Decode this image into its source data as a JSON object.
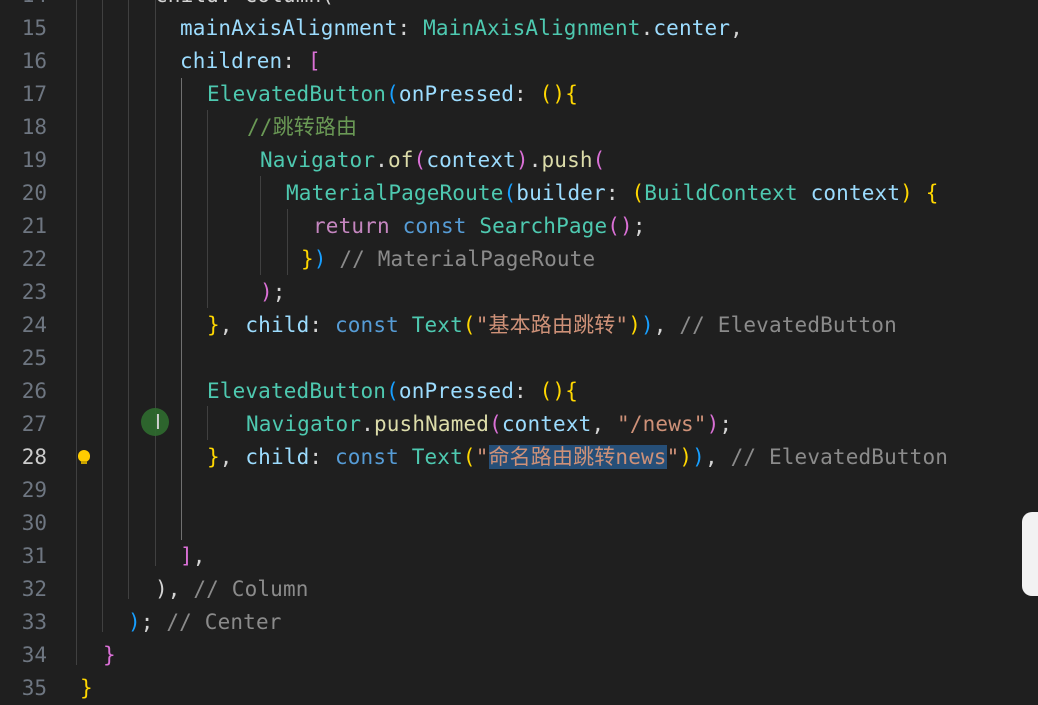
{
  "editor": {
    "language": "dart",
    "active_line": 28,
    "selected_text": "命名路由跳转news",
    "lines": [
      {
        "n": "14",
        "tokens": [
          {
            "t": "child: Column(",
            "c": "t-p"
          }
        ]
      },
      {
        "n": "15",
        "tokens": [
          {
            "t": "mainAxisAlignment",
            "c": "t-prop"
          },
          {
            "t": ": ",
            "c": "t-p"
          },
          {
            "t": "MainAxisAlignment",
            "c": "t-cls"
          },
          {
            "t": ".",
            "c": "t-p"
          },
          {
            "t": "center",
            "c": "t-prop"
          },
          {
            "t": ",",
            "c": "t-p"
          }
        ]
      },
      {
        "n": "16",
        "tokens": [
          {
            "t": "children",
            "c": "t-prop"
          },
          {
            "t": ": ",
            "c": "t-p"
          },
          {
            "t": "[",
            "c": "b2"
          }
        ]
      },
      {
        "n": "17",
        "tokens": [
          {
            "t": "ElevatedButton",
            "c": "t-cls"
          },
          {
            "t": "(",
            "c": "b3"
          },
          {
            "t": "onPressed",
            "c": "t-prop"
          },
          {
            "t": ": ",
            "c": "t-p"
          },
          {
            "t": "(){",
            "c": "b1"
          }
        ]
      },
      {
        "n": "18",
        "tokens": [
          {
            "t": "//跳转路由",
            "c": "t-com"
          }
        ]
      },
      {
        "n": "19",
        "tokens": [
          {
            "t": "Navigator",
            "c": "t-cls"
          },
          {
            "t": ".",
            "c": "t-p"
          },
          {
            "t": "of",
            "c": "t-fn"
          },
          {
            "t": "(",
            "c": "b2"
          },
          {
            "t": "context",
            "c": "t-prop"
          },
          {
            "t": ")",
            "c": "b2"
          },
          {
            "t": ".",
            "c": "t-p"
          },
          {
            "t": "push",
            "c": "t-fn"
          },
          {
            "t": "(",
            "c": "b2"
          }
        ]
      },
      {
        "n": "20",
        "tokens": [
          {
            "t": "MaterialPageRoute",
            "c": "t-cls"
          },
          {
            "t": "(",
            "c": "b3"
          },
          {
            "t": "builder",
            "c": "t-prop"
          },
          {
            "t": ": ",
            "c": "t-p"
          },
          {
            "t": "(",
            "c": "b1"
          },
          {
            "t": "BuildContext",
            "c": "t-cls"
          },
          {
            "t": " ",
            "c": "t-p"
          },
          {
            "t": "context",
            "c": "t-prop"
          },
          {
            "t": ")",
            "c": "b1"
          },
          {
            "t": " ",
            "c": "t-p"
          },
          {
            "t": "{",
            "c": "b1"
          }
        ]
      },
      {
        "n": "21",
        "tokens": [
          {
            "t": "return",
            "c": "t-ctrl"
          },
          {
            "t": " ",
            "c": "t-p"
          },
          {
            "t": "const",
            "c": "t-kw"
          },
          {
            "t": " ",
            "c": "t-p"
          },
          {
            "t": "SearchPage",
            "c": "t-cls"
          },
          {
            "t": "()",
            "c": "b2"
          },
          {
            "t": ";",
            "c": "t-p"
          }
        ]
      },
      {
        "n": "22",
        "tokens": [
          {
            "t": "}",
            "c": "b1"
          },
          {
            "t": ")",
            "c": "b3"
          },
          {
            "t": " // MaterialPageRoute",
            "c": "t-com2"
          }
        ]
      },
      {
        "n": "23",
        "tokens": [
          {
            "t": ")",
            "c": "b2"
          },
          {
            "t": ";",
            "c": "t-p"
          }
        ]
      },
      {
        "n": "24",
        "tokens": [
          {
            "t": "}",
            "c": "b1"
          },
          {
            "t": ", ",
            "c": "t-p"
          },
          {
            "t": "child",
            "c": "t-prop"
          },
          {
            "t": ": ",
            "c": "t-p"
          },
          {
            "t": "const",
            "c": "t-kw"
          },
          {
            "t": " ",
            "c": "t-p"
          },
          {
            "t": "Text",
            "c": "t-cls"
          },
          {
            "t": "(",
            "c": "b1"
          },
          {
            "t": "\"基本路由跳转\"",
            "c": "t-str"
          },
          {
            "t": ")",
            "c": "b1"
          },
          {
            "t": ")",
            "c": "b3"
          },
          {
            "t": ", ",
            "c": "t-p"
          },
          {
            "t": "// ElevatedButton",
            "c": "t-com2"
          }
        ]
      },
      {
        "n": "25",
        "tokens": []
      },
      {
        "n": "26",
        "tokens": [
          {
            "t": "ElevatedButton",
            "c": "t-cls"
          },
          {
            "t": "(",
            "c": "b3"
          },
          {
            "t": "onPressed",
            "c": "t-prop"
          },
          {
            "t": ": ",
            "c": "t-p"
          },
          {
            "t": "(){",
            "c": "b1"
          }
        ]
      },
      {
        "n": "27",
        "tokens": [
          {
            "t": "Navigator",
            "c": "t-cls"
          },
          {
            "t": ".",
            "c": "t-p"
          },
          {
            "t": "pushNamed",
            "c": "t-fn"
          },
          {
            "t": "(",
            "c": "b2"
          },
          {
            "t": "context",
            "c": "t-prop"
          },
          {
            "t": ", ",
            "c": "t-p"
          },
          {
            "t": "\"/news\"",
            "c": "t-str"
          },
          {
            "t": ")",
            "c": "b2"
          },
          {
            "t": ";",
            "c": "t-p"
          }
        ]
      },
      {
        "n": "28",
        "tokens": [
          {
            "t": "}",
            "c": "b1"
          },
          {
            "t": ", ",
            "c": "t-p"
          },
          {
            "t": "child",
            "c": "t-prop"
          },
          {
            "t": ": ",
            "c": "t-p"
          },
          {
            "t": "const",
            "c": "t-kw"
          },
          {
            "t": " ",
            "c": "t-p"
          },
          {
            "t": "Text",
            "c": "t-cls"
          },
          {
            "t": "(",
            "c": "b1"
          },
          {
            "t": "\"",
            "c": "t-str"
          },
          {
            "t": "命名路由跳转news",
            "c": "t-str sel"
          },
          {
            "t": "\"",
            "c": "t-str"
          },
          {
            "t": ")",
            "c": "b1"
          },
          {
            "t": ")",
            "c": "b3"
          },
          {
            "t": ", ",
            "c": "t-p"
          },
          {
            "t": "// ElevatedButton",
            "c": "t-com2"
          }
        ]
      },
      {
        "n": "29",
        "tokens": []
      },
      {
        "n": "30",
        "tokens": []
      },
      {
        "n": "31",
        "tokens": [
          {
            "t": "]",
            "c": "b2"
          },
          {
            "t": ",",
            "c": "t-p"
          }
        ]
      },
      {
        "n": "32",
        "tokens": [
          {
            "t": ")",
            "c": "t-p"
          },
          {
            "t": ", ",
            "c": "t-p"
          },
          {
            "t": "// Column",
            "c": "t-com2"
          }
        ]
      },
      {
        "n": "33",
        "tokens": [
          {
            "t": ")",
            "c": "b3"
          },
          {
            "t": "; ",
            "c": "t-p"
          },
          {
            "t": "// Center",
            "c": "t-com2"
          }
        ]
      },
      {
        "n": "34",
        "tokens": [
          {
            "t": "}",
            "c": "b2"
          }
        ]
      },
      {
        "n": "35",
        "tokens": [
          {
            "t": "}",
            "c": "b1"
          }
        ]
      }
    ]
  },
  "icons": {
    "lightbulb": "lightbulb-icon",
    "text_cursor": "text-cursor-icon"
  },
  "colors": {
    "background": "#1f1f1f",
    "selection": "#264f78",
    "line_number": "#6e7681",
    "line_number_active": "#cccccc"
  }
}
